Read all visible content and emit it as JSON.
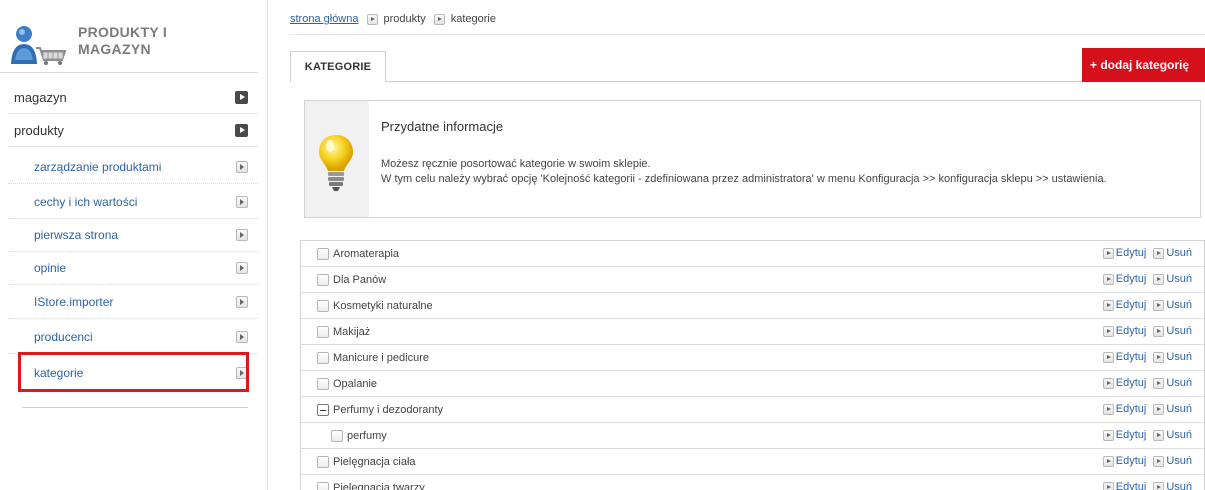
{
  "sidebar": {
    "title_line1": "PRODUKTY I",
    "title_line2": "MAGAZYN",
    "top_items": [
      {
        "label": "magazyn",
        "icon": "play-dark-icon"
      },
      {
        "label": "produkty",
        "icon": "play-dark-icon"
      }
    ],
    "sub_items": [
      {
        "label": "zarządzanie produktami",
        "icon": "play-light-icon"
      },
      {
        "label": "cechy i ich wartości",
        "icon": "play-light-icon"
      },
      {
        "label": "pierwsza strona",
        "icon": "play-light-icon"
      },
      {
        "label": "opinie",
        "icon": "play-light-icon"
      },
      {
        "label": "IStore.importer",
        "icon": "play-light-icon"
      },
      {
        "label": "producenci",
        "icon": "play-light-icon"
      },
      {
        "label": "kategorie",
        "icon": "play-light-icon",
        "highlighted": true
      }
    ]
  },
  "breadcrumb": {
    "home": "strona główna",
    "level1": "produkty",
    "level2": "kategorie"
  },
  "tabs": {
    "active": "KATEGORIE"
  },
  "add_button": "+ dodaj kategorię",
  "info": {
    "title": "Przydatne informacje",
    "line1": "Możesz ręcznie posortować kategorie w swoim sklepie.",
    "line2": "W tym celu należy wybrać opcję 'Kolejność kategorii - zdefiniowana przez administratora' w menu Konfiguracja >> konfiguracja sklepu >> ustawienia."
  },
  "categories": {
    "edit_label": "Edytuj",
    "delete_label": "Usuń",
    "items": [
      {
        "name": "Aromaterapia",
        "expanded": false,
        "level": 0
      },
      {
        "name": "Dla Panów",
        "expanded": false,
        "level": 0
      },
      {
        "name": "Kosmetyki naturalne",
        "expanded": false,
        "level": 0
      },
      {
        "name": "Makijaż",
        "expanded": false,
        "level": 0
      },
      {
        "name": "Manicure i pedicure",
        "expanded": false,
        "level": 0
      },
      {
        "name": "Opalanie",
        "expanded": false,
        "level": 0
      },
      {
        "name": "Perfumy i dezodoranty",
        "expanded": true,
        "level": 0
      },
      {
        "name": "perfumy",
        "expanded": false,
        "level": 1
      },
      {
        "name": "Pielęgnacja ciała",
        "expanded": false,
        "level": 0
      },
      {
        "name": "Pielęgnacja twarzy",
        "expanded": false,
        "level": 0
      }
    ]
  },
  "colors": {
    "accent_red": "#d6101b",
    "link_blue": "#2d63a6",
    "highlight_red": "#e0171d"
  }
}
